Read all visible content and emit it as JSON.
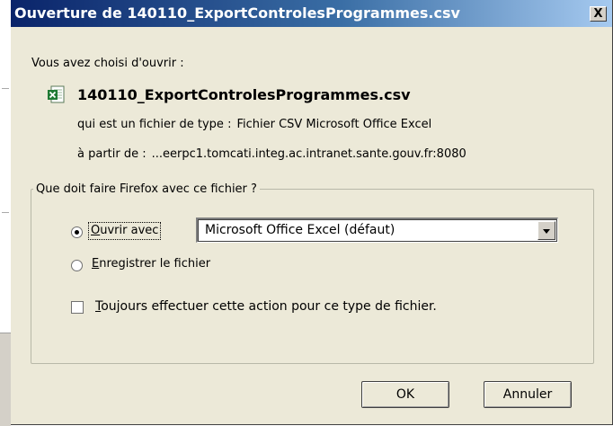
{
  "window": {
    "title": "Ouverture de 140110_ExportControlesProgrammes.csv",
    "close_glyph": "X"
  },
  "intro_text": "Vous avez choisi d'ouvrir :",
  "file": {
    "icon": "excel-csv-file-icon",
    "name": "140110_ExportControlesProgrammes.csv",
    "type_label": "qui est un fichier de type :",
    "type_value": "Fichier CSV Microsoft Office Excel",
    "from_label": "à partir de :",
    "from_value": "...eerpc1.tomcati.integ.ac.intranet.sante.gouv.fr:8080"
  },
  "action_group": {
    "legend": "Que doit faire Firefox avec ce fichier ?",
    "open_with": {
      "accesskey": "O",
      "rest": "uvrir avec",
      "checked": true
    },
    "app_select": {
      "selected": "Microsoft Office Excel (défaut)"
    },
    "save_file": {
      "accesskey": "E",
      "rest": "nregistrer le fichier",
      "checked": false
    },
    "always": {
      "accesskey": "T",
      "rest": "oujours effectuer cette action pour ce type de fichier.",
      "checked": false
    }
  },
  "buttons": {
    "ok": "OK",
    "cancel": "Annuler"
  },
  "colors": {
    "title_bar_start": "#0a246a",
    "title_bar_end": "#a6caf0",
    "dialog_bg": "#ece9d8"
  }
}
